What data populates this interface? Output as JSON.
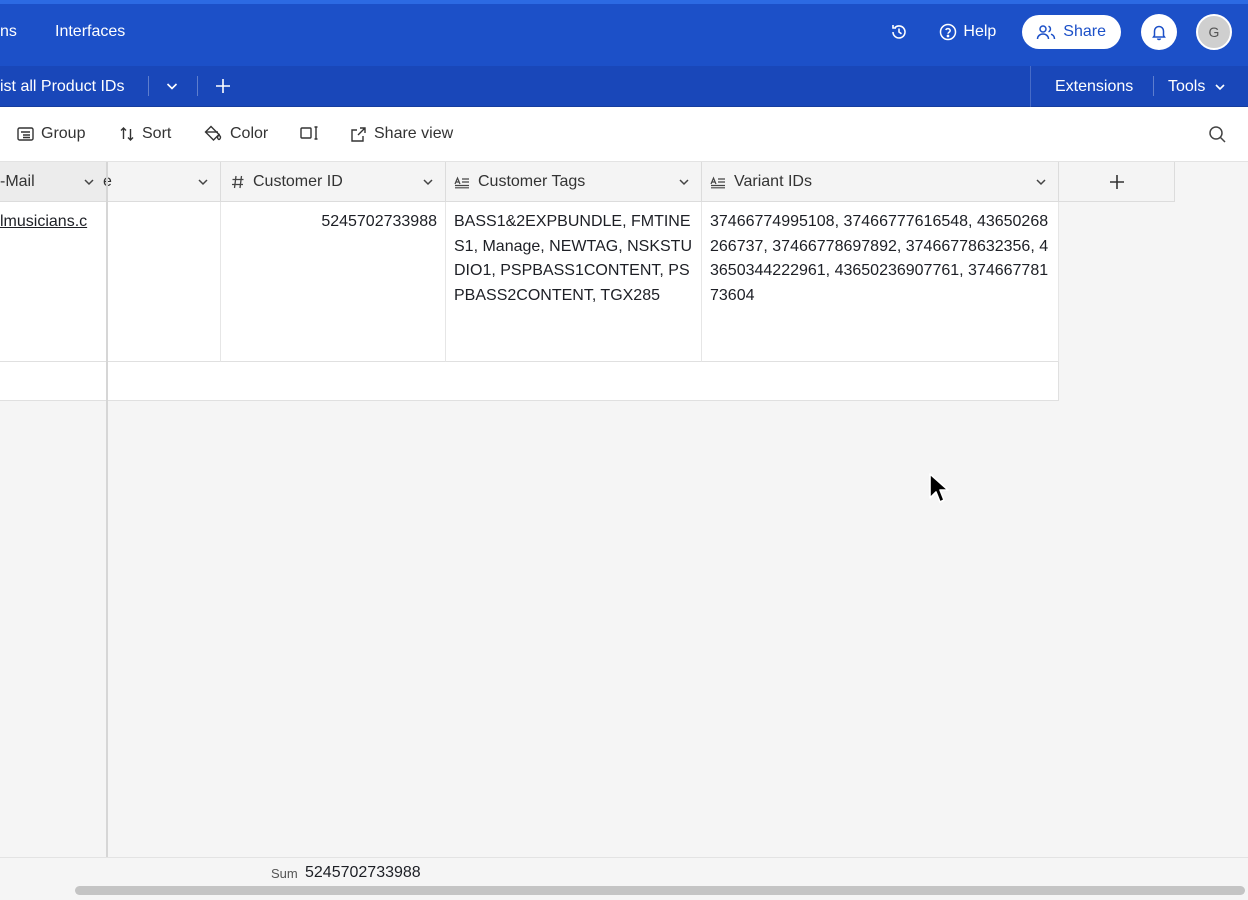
{
  "topnav": {
    "left_partial": "ns",
    "interfaces": "Interfaces",
    "help": "Help",
    "share": "Share",
    "avatar_initial": "G"
  },
  "tabbar": {
    "view_name": "ist all Product IDs",
    "extensions": "Extensions",
    "tools": "Tools"
  },
  "toolbar": {
    "group": "Group",
    "sort": "Sort",
    "color": "Color",
    "share_view": "Share view"
  },
  "grid": {
    "columns": [
      {
        "label": "-Mail"
      },
      {
        "label": "e"
      },
      {
        "label": "Customer ID"
      },
      {
        "label": "Customer Tags"
      },
      {
        "label": "Variant IDs"
      }
    ],
    "row": {
      "email": "lmusicians.c",
      "blank": "",
      "customer_id": "5245702733988",
      "customer_tags": "BASS1&2EXPBUNDLE, FMTINES1, Manage, NEWTAG, NSKSTUDIO1, PSPBASS1CONTENT, PSPBASS2CONTENT, TGX285",
      "variant_ids": "37466774995108, 37466777616548, 43650268266737, 37466778697892, 37466778632356, 43650344222961, 43650236907761, 37466778173604"
    }
  },
  "footer": {
    "sum_label": "Sum",
    "sum_value": "5245702733988"
  },
  "colors": {
    "nav_blue": "#1c50c8",
    "tab_blue": "#1947b9",
    "header_gray": "#f4f4f4"
  },
  "icons": [
    "history-icon",
    "help-icon",
    "share-icon",
    "bell-icon",
    "chevron-down-icon",
    "plus-icon",
    "group-icon",
    "sort-icon",
    "color-icon",
    "row-height-icon",
    "share-view-icon",
    "search-icon",
    "hash-icon",
    "long-text-icon",
    "cursor-icon"
  ]
}
